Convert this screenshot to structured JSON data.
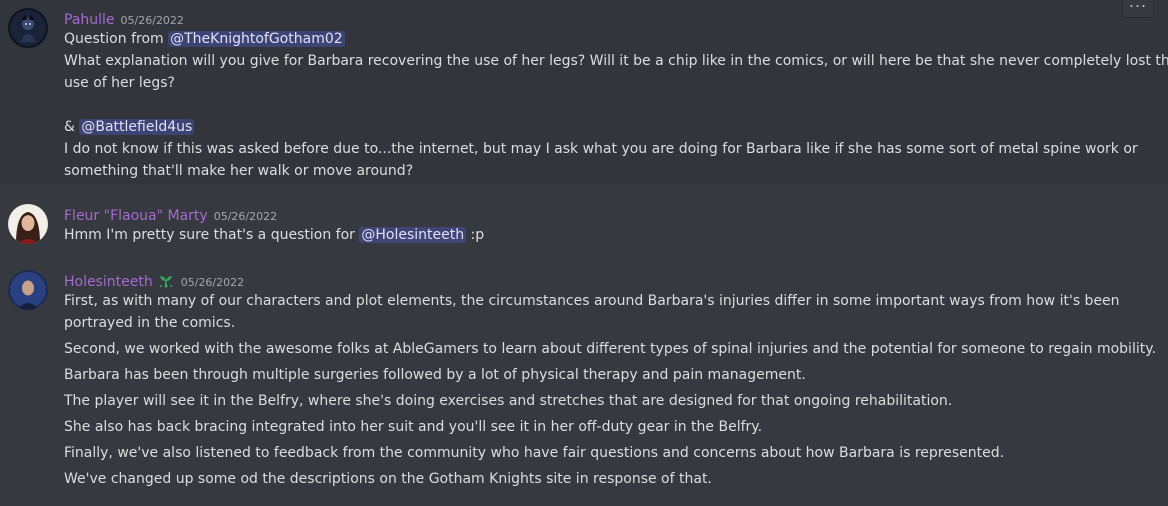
{
  "messages": [
    {
      "author": "Pahulle",
      "timestamp": "05/26/2022",
      "lines": [
        {
          "pre": "Question from ",
          "mention": "@TheKnightofGotham02",
          "post": ""
        },
        {
          "text": "What explanation will you give for Barbara recovering the use of her legs? Will it be a chip like in the comics, or will here be that she never completely lost the"
        },
        {
          "text": "use of her legs?"
        },
        {
          "pre": "& ",
          "mention": "@Battlefield4us",
          "post": ""
        },
        {
          "text": "I do not know if this was asked before due to...the internet, but may I ask what you are doing for Barbara like if she has some sort of metal spine work or"
        },
        {
          "text": "something that'll make her walk or move around?"
        }
      ]
    },
    {
      "author": "Fleur \"Flaoua\" Marty",
      "timestamp": "05/26/2022",
      "lines": [
        {
          "pre": "Hmm I'm pretty sure that's a question for ",
          "mention": "@Holesinteeth",
          "post": " :p"
        }
      ]
    },
    {
      "author": "Holesinteeth",
      "timestamp": "05/26/2022",
      "badge": "sprout-icon",
      "lines": [
        {
          "text": "First, as with many of our characters and plot elements, the circumstances around Barbara's injuries differ in some important ways from how it's been"
        },
        {
          "text": "portrayed in the comics."
        },
        {
          "text": "Second, we worked with the awesome folks at AbleGamers to learn about different types of spinal injuries and the potential for someone to regain mobility."
        },
        {
          "text": "Barbara has been through multiple surgeries followed by a lot of physical therapy and pain management."
        },
        {
          "text": "The player will see it in the Belfry, where she's doing exercises and stretches that are designed for that ongoing rehabilitation."
        },
        {
          "text": "She also has back bracing integrated into her suit and you'll see it in her off-duty gear in the Belfry."
        },
        {
          "text": "Finally, we've also listened to feedback from the community who have fair questions and concerns about how Barbara is represented."
        },
        {
          "text": "We've changed up some od the descriptions on the Gotham Knights site in response of that."
        }
      ]
    }
  ],
  "toolbar": {
    "more_label": "..."
  },
  "colors": {
    "background": "#36393f",
    "hover_background": "#32353b",
    "username": "#a56ad0",
    "mention_bg": "rgba(88,101,242,0.3)"
  }
}
